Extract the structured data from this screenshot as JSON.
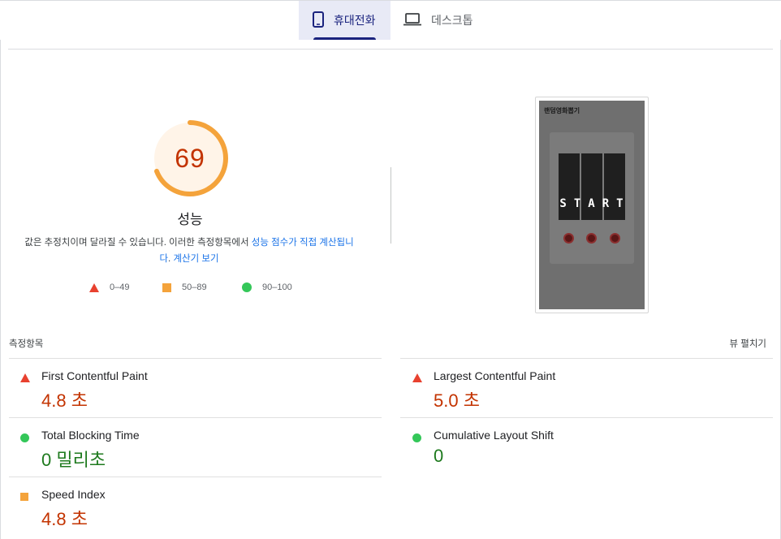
{
  "tabs": [
    {
      "label": "휴대전화",
      "icon": "smartphone-icon",
      "selected": true
    },
    {
      "label": "데스크톱",
      "icon": "laptop-icon",
      "selected": false
    }
  ],
  "score": {
    "value": 69,
    "label": "성능",
    "gauge_fraction": 0.69,
    "color": "#c33300",
    "ring_color": "#f4a33b",
    "bg_color": "#fff4e8"
  },
  "description": {
    "text": "값은 추정치이며 달라질 수 있습니다. 이러한 측정항목에서 ",
    "link1": "성능 점수가 직접 계산됩니다",
    "text2": ". ",
    "link2": "계산기 보기"
  },
  "legend": [
    {
      "range": "0–49",
      "shape": "triangle",
      "color": "#e8412f"
    },
    {
      "range": "50–89",
      "shape": "square",
      "color": "#f4a33b"
    },
    {
      "range": "90–100",
      "shape": "circle",
      "color": "#34c759"
    }
  ],
  "thumbnail": {
    "title": "랜덤영화뽑기",
    "button_text": "START"
  },
  "metrics_section": {
    "title": "측정항목",
    "expand_label": "뷰 펼치기"
  },
  "metrics": [
    {
      "label": "First Contentful Paint",
      "value": "4.8 초",
      "rating": "poor"
    },
    {
      "label": "Largest Contentful Paint",
      "value": "5.0 초",
      "rating": "poor"
    },
    {
      "label": "Total Blocking Time",
      "value": "0 밀리초",
      "rating": "good"
    },
    {
      "label": "Cumulative Layout Shift",
      "value": "0",
      "rating": "good"
    },
    {
      "label": "Speed Index",
      "value": "4.8 초",
      "rating": "average"
    }
  ]
}
